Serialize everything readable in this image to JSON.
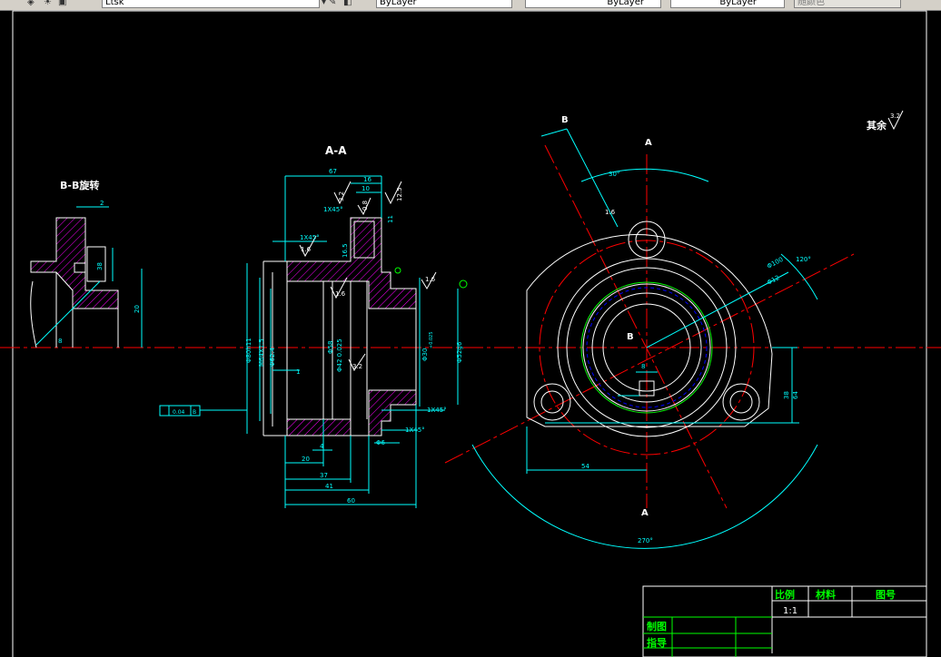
{
  "toolbar": {
    "file_field": "Ltsk",
    "layer_color": "ByLayer",
    "linetype": "ByLayer",
    "lineweight": "ByLayer",
    "plot_style": "随颜色",
    "icons": [
      "layer-icon",
      "layer-state-icon",
      "match-icon"
    ]
  },
  "drawing": {
    "section_aa_title": "A-A",
    "section_bb_title": "B-B旋转",
    "surface_note": "其余",
    "roughness_rest": "3.2",
    "section_mark_a": "A",
    "section_mark_b": "B",
    "dims_aa": {
      "d67": "67",
      "d16": "16",
      "d10": "10",
      "d5": "5",
      "chamfer1": "1X45°",
      "chamfer2": "1X45°",
      "chamfer3": "1X45°",
      "chamfer4": "1X45°",
      "r32a": "3.2",
      "r32b": "3.2",
      "r16a": "1.6",
      "r16b": "1.6",
      "r16c": "1.6",
      "r16d": "1.6",
      "r16e": "1.6",
      "r08": "0.8",
      "r32c": "3.2",
      "r125": "12.5",
      "d11": "11",
      "d165": "16.5",
      "phi80": "Φ80h11",
      "thread": "M64X1.5",
      "phi624": "Φ62.4",
      "phi42": "Φ42 0.025",
      "phi58": "Φ58",
      "phi52": "Φ52g6",
      "phi30": "Φ30",
      "sup_tol": "+0.025",
      "phi72": "Φ72",
      "d1": "1",
      "d4": "4",
      "d20": "20",
      "d37": "37",
      "d41": "41",
      "d60": "60",
      "d15": "1X45°",
      "phi6": "Φ6",
      "gdt_tol": "0.04",
      "gdt_datum": "B",
      "datum_label": "B"
    },
    "dims_bb": {
      "d2": "2",
      "d38": "38",
      "d20": "20",
      "d8": "8"
    },
    "dims_front": {
      "a30": "30°",
      "a120": "120°",
      "a270": "270°",
      "r8": "8",
      "d64": "64",
      "d38": "38",
      "d54": "54",
      "phi100": "Φ100",
      "phi12": "Φ12"
    },
    "title_block": {
      "scale_label": "比例",
      "material_label": "材料",
      "drawing_no_label": "图号",
      "scale_value": "1:1",
      "drawn_label": "制图",
      "guide_label": "指导"
    }
  },
  "colors": {
    "background": "#000000",
    "outline": "#ffffff",
    "dimension": "#00ffff",
    "centerline": "#ff0000",
    "hatch": "#ff00ff",
    "hidden": "#0000ff",
    "thread": "#00ff00",
    "title_block": "#00ff00"
  }
}
